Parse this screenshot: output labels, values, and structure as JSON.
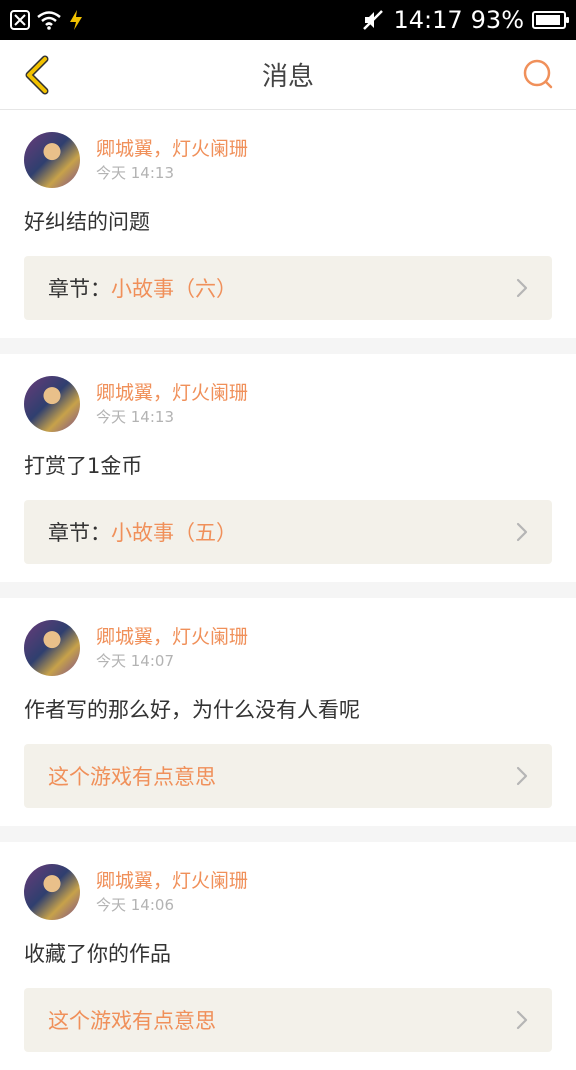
{
  "status_bar": {
    "time": "14:17",
    "battery": "93%",
    "battery_level": 0.93,
    "icons": [
      "notification-icon",
      "wifi-icon",
      "charging-icon",
      "silent-icon",
      "battery-icon"
    ]
  },
  "nav": {
    "title": "消息",
    "back_icon": "chevron-left-icon",
    "search_icon": "search-icon"
  },
  "colors": {
    "accent": "#f0905a",
    "back_arrow": "#f2c200"
  },
  "messages": [
    {
      "name": "卿城翼，灯火阑珊",
      "time": "今天 14:13",
      "text": "好纠结的问题",
      "ref_prefix": "章节：",
      "ref_value": "小故事（六）"
    },
    {
      "name": "卿城翼，灯火阑珊",
      "time": "今天 14:13",
      "text": "打赏了1金币",
      "ref_prefix": "章节：",
      "ref_value": "小故事（五）"
    },
    {
      "name": "卿城翼，灯火阑珊",
      "time": "今天 14:07",
      "text": "作者写的那么好，为什么没有人看呢",
      "ref_prefix": "",
      "ref_value": "这个游戏有点意思"
    },
    {
      "name": "卿城翼，灯火阑珊",
      "time": "今天 14:06",
      "text": "收藏了你的作品",
      "ref_prefix": "",
      "ref_value": "这个游戏有点意思"
    }
  ]
}
